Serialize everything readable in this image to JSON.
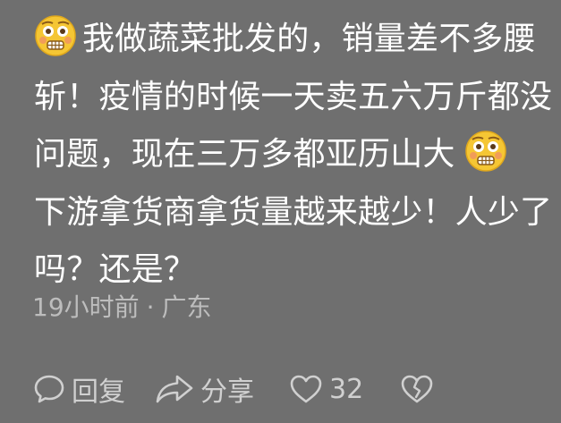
{
  "comment": {
    "lines": [
      "我做蔬菜批发的，销量差不多腰",
      "斩！疫情的时候一天卖五六万斤都没",
      "问题，现在三万多都亚历山大",
      "下游拿货商拿货量越来越少！人少了",
      "吗？还是？"
    ],
    "time": "19小时前",
    "separator": "·",
    "location": "广东"
  },
  "actions": {
    "reply_label": "回复",
    "share_label": "分享",
    "like_count": "32"
  },
  "icons": {
    "emoji": "flushed-grimace-emoji",
    "reply": "speech-bubble-icon",
    "share": "share-arrow-icon",
    "like": "heart-icon",
    "dislike": "broken-heart-icon"
  },
  "colors": {
    "background": "#6f6f6f",
    "text": "#ffffff",
    "meta": "#bdbdbd",
    "emoji_face": "#f5c634"
  }
}
